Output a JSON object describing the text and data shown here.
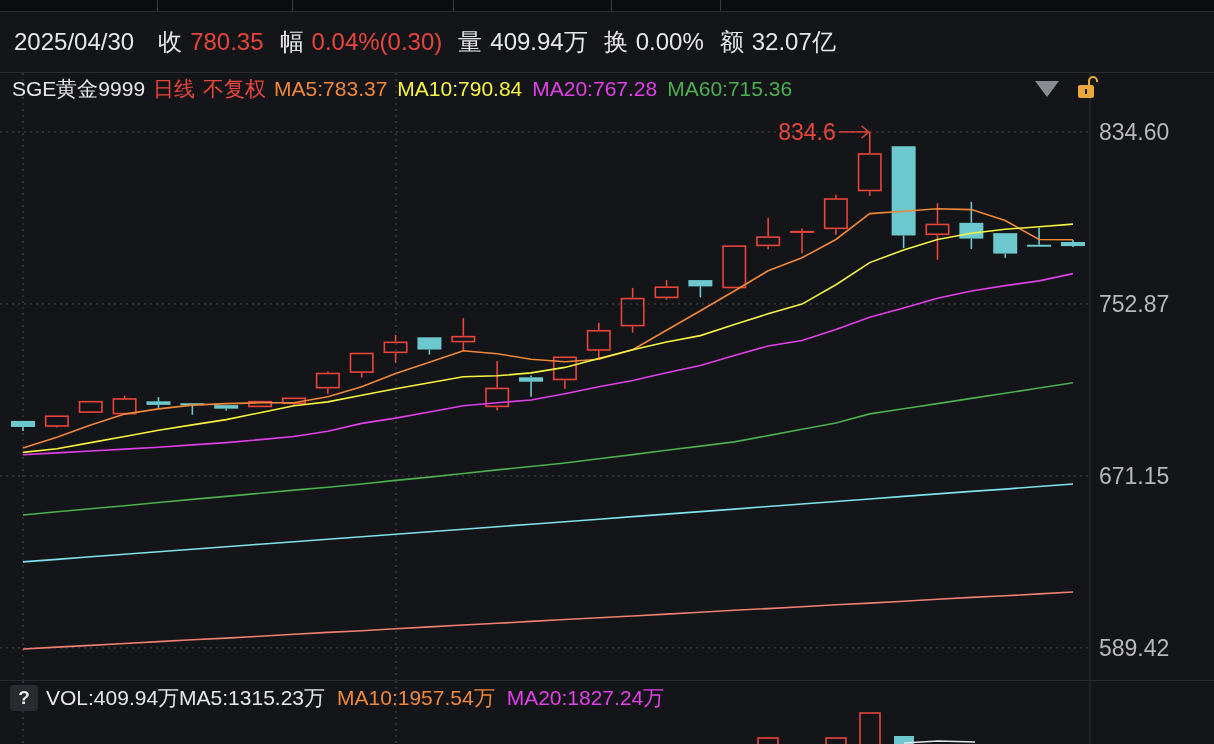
{
  "quote_bar": {
    "date": "2025/04/30",
    "fields": [
      {
        "label": "收",
        "value": "780.35",
        "color": "#e8453c"
      },
      {
        "label": "幅",
        "value": "0.04%(0.30)",
        "color": "#e8453c"
      },
      {
        "label": "量",
        "value": "409.94万",
        "color": "#e6e6e6"
      },
      {
        "label": "换",
        "value": "0.00%",
        "color": "#e6e6e6"
      },
      {
        "label": "额",
        "value": "32.07亿",
        "color": "#e6e6e6"
      }
    ]
  },
  "legend": {
    "symbol": "SGE黄金9999",
    "tags": [
      "日线",
      "不复权"
    ]
  },
  "price_chart": {
    "chart_data": {
      "type": "line",
      "ylim": [
        573.7,
        862.6
      ],
      "grid": true,
      "yticks": [
        {
          "value": 834.6,
          "label": "834.60"
        },
        {
          "value": 752.87,
          "label": "752.87"
        },
        {
          "value": 671.15,
          "label": "671.15"
        },
        {
          "value": 589.42,
          "label": "589.42"
        }
      ],
      "annotations": [
        {
          "text": "834.6"
        }
      ],
      "series": [
        {
          "name": "MA5:783.37",
          "color": "#f0883a",
          "values": [
            684.4,
            689.5,
            695.4,
            700.5,
            703.0,
            704.8,
            705.5,
            705.9,
            705.9,
            708.8,
            713.5,
            719.8,
            725.2,
            730.6,
            729.2,
            726.6,
            725.4,
            726.6,
            731.1,
            740.4,
            749.6,
            759.0,
            768.6,
            774.8,
            783.5,
            795.8,
            796.9,
            798.1,
            797.7,
            792.5,
            783.5,
            783.4
          ]
        },
        {
          "name": "MA10:790.84",
          "color": "#f5f542",
          "values": [
            682.3,
            684.1,
            687.0,
            689.9,
            692.8,
            695.4,
            697.9,
            701.2,
            704.5,
            706.3,
            709.5,
            712.6,
            715.4,
            718.3,
            718.7,
            720.1,
            722.7,
            727.0,
            731.1,
            734.8,
            737.8,
            743.1,
            748.2,
            752.8,
            762.0,
            772.5,
            778.5,
            783.5,
            786.5,
            788.4,
            789.5,
            790.8
          ]
        },
        {
          "name": "MA20:767.28",
          "color": "#e040e8",
          "values": [
            681.2,
            682.1,
            683.0,
            683.9,
            684.8,
            685.9,
            687.0,
            688.4,
            689.9,
            692.4,
            696.1,
            698.6,
            701.5,
            704.5,
            705.9,
            707.2,
            710.2,
            713.5,
            716.5,
            720.2,
            723.6,
            728.3,
            732.9,
            735.5,
            740.7,
            746.5,
            751.0,
            755.6,
            759.0,
            761.6,
            763.8,
            767.3
          ]
        },
        {
          "name": "MA60:715.36",
          "color": "#4caf50",
          "values": [
            652.6,
            654.1,
            655.5,
            657.0,
            658.5,
            660.0,
            661.4,
            662.9,
            664.4,
            665.8,
            667.3,
            669.0,
            670.6,
            672.3,
            674.0,
            675.6,
            677.3,
            679.3,
            681.3,
            683.3,
            685.3,
            687.3,
            690.3,
            693.3,
            696.3,
            700.6,
            703.1,
            705.5,
            708.0,
            710.4,
            712.9,
            715.4
          ]
        },
        {
          "color": "#7fe3ee",
          "values": [
            630.3,
            631.5,
            632.7,
            633.9,
            635.1,
            636.3,
            637.5,
            638.7,
            639.9,
            641.1,
            642.2,
            643.4,
            644.6,
            645.8,
            647.0,
            648.2,
            649.4,
            650.6,
            651.8,
            653.0,
            654.2,
            655.4,
            656.6,
            657.8,
            659.0,
            660.2,
            661.4,
            662.6,
            663.8,
            664.9,
            666.1,
            667.3
          ]
        },
        {
          "color": "#f08070",
          "values": [
            588.9,
            589.8,
            590.6,
            591.5,
            592.4,
            593.3,
            594.1,
            595.0,
            595.9,
            596.8,
            597.6,
            598.5,
            599.4,
            600.3,
            601.1,
            602.0,
            602.9,
            603.8,
            604.6,
            605.5,
            606.4,
            607.3,
            608.1,
            609.0,
            609.9,
            610.7,
            611.6,
            612.5,
            613.4,
            614.2,
            615.1,
            616.0
          ]
        }
      ]
    }
  },
  "volume_panel": {
    "help_button": "?",
    "indicators": [
      {
        "text": "VOL:409.94万",
        "color": "#e6e6e6"
      },
      {
        "text": "MA5:1315.23万",
        "color": "#e6e6e6"
      },
      {
        "text": "MA10:1957.54万",
        "color": "#f0883a"
      },
      {
        "text": "MA20:1827.24万",
        "color": "#e040e8"
      }
    ]
  }
}
